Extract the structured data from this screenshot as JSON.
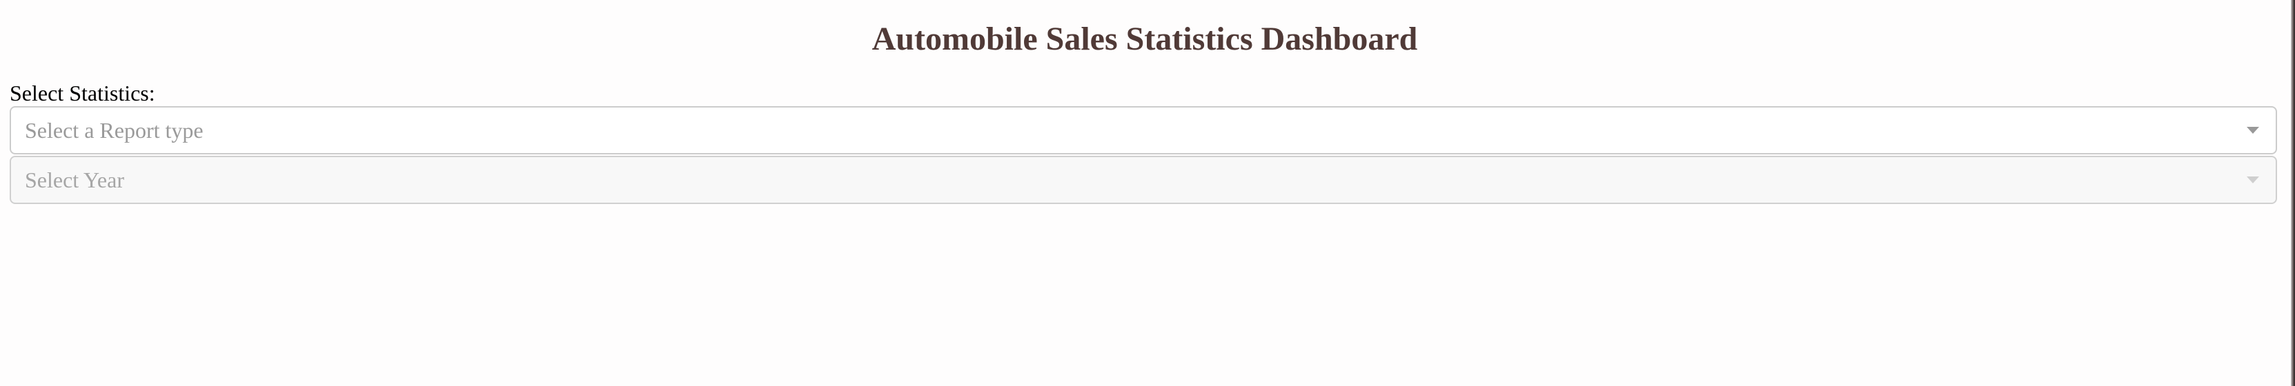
{
  "header": {
    "title": "Automobile Sales Statistics Dashboard"
  },
  "controls": {
    "statistics_label": "Select Statistics:",
    "report_dropdown": {
      "placeholder": "Select a Report type",
      "icon": "chevron-down-icon",
      "enabled": true
    },
    "year_dropdown": {
      "placeholder": "Select Year",
      "icon": "chevron-down-icon",
      "enabled": false
    }
  },
  "colors": {
    "title": "#503a37",
    "placeholder": "#9a9a9a",
    "border": "#cccccc",
    "disabled_background": "#f8f8f8"
  }
}
